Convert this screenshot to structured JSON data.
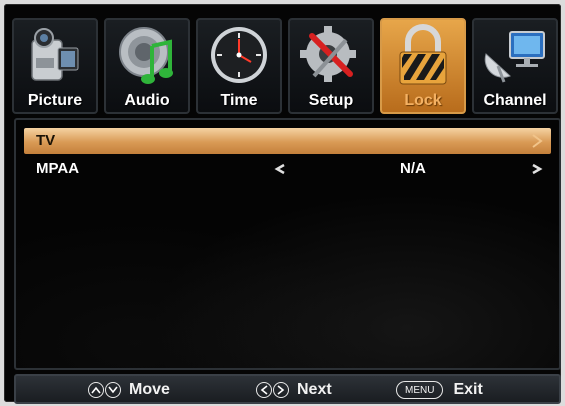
{
  "tabs": [
    {
      "label": "Picture",
      "icon": "camcorder-icon",
      "active": false
    },
    {
      "label": "Audio",
      "icon": "music-note-icon",
      "active": false
    },
    {
      "label": "Time",
      "icon": "clock-icon",
      "active": false
    },
    {
      "label": "Setup",
      "icon": "gear-tools-icon",
      "active": false
    },
    {
      "label": "Lock",
      "icon": "padlock-icon",
      "active": true
    },
    {
      "label": "Channel",
      "icon": "satellite-dish-icon",
      "active": false
    }
  ],
  "menu_rows": [
    {
      "name": "TV",
      "value": "",
      "selected": true
    },
    {
      "name": "MPAA",
      "value": "N/A",
      "selected": false
    }
  ],
  "footer": {
    "move_label": "Move",
    "next_label": "Next",
    "menu_key_label": "MENU",
    "exit_label": "Exit"
  },
  "colors": {
    "active_tab": "#d8893a",
    "selected_row": "#e0a862",
    "background": "#050505"
  }
}
